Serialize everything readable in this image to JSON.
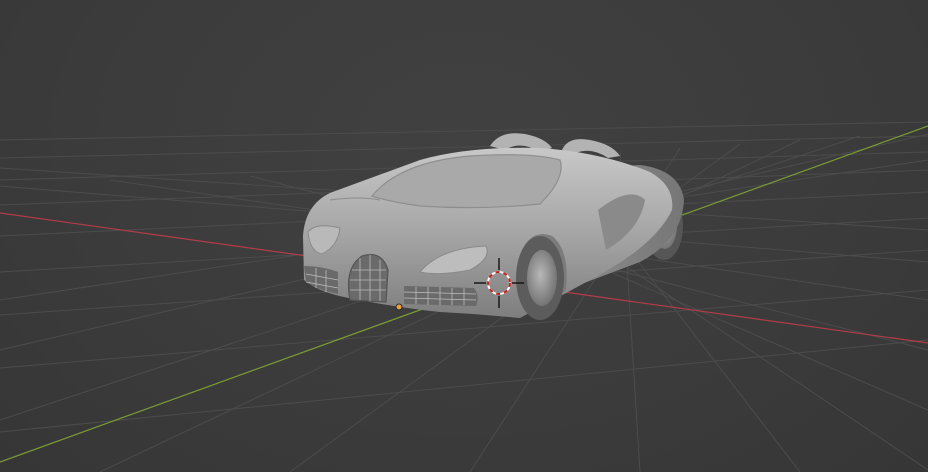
{
  "viewport": {
    "background_color": "#3d3d3d",
    "grid_color": "#4a4a4a",
    "x_axis_color": "#c0424f",
    "y_axis_color": "#86a536",
    "model_color": "#a8a8a8",
    "cursor_colors": [
      "#cf2020",
      "#ffffff"
    ],
    "origin_color": "#e8a23b",
    "model": "car-mesh",
    "tool": "3d-cursor"
  }
}
